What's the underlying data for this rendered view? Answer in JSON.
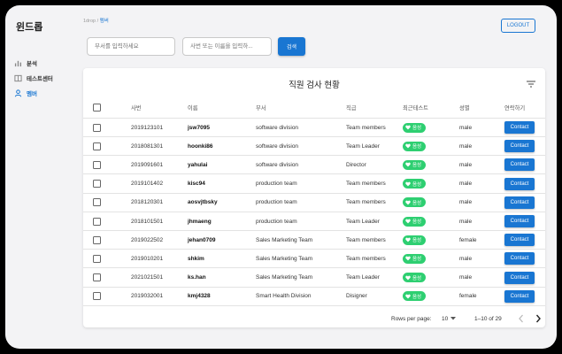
{
  "app": {
    "title": "윈드롭"
  },
  "sidebar": {
    "items": [
      {
        "label": "분석",
        "icon": "bar-chart-icon"
      },
      {
        "label": "테스트센터",
        "icon": "book-icon"
      },
      {
        "label": "멤버",
        "icon": "person-icon"
      }
    ]
  },
  "breadcrumb": {
    "root": "1drop",
    "sep": "/",
    "current": "멤버"
  },
  "header": {
    "logout_label": "LOGOUT"
  },
  "search": {
    "dept_placeholder": "부서를 입력하세요",
    "name_placeholder": "사번 또는 이름을 입력하...",
    "button_label": "검색"
  },
  "table": {
    "title": "직원 검사 현황",
    "columns": [
      "사번",
      "이름",
      "부서",
      "직급",
      "최근테스트",
      "성별",
      "연락하기"
    ],
    "rows": [
      {
        "id": "2019123101",
        "name": "jsw7095",
        "dept": "software division",
        "rank": "Team members",
        "test": "음성",
        "gender": "male",
        "contact": "Contact"
      },
      {
        "id": "2018081301",
        "name": "hoonki86",
        "dept": "software division",
        "rank": "Team Leader",
        "test": "음성",
        "gender": "male",
        "contact": "Contact"
      },
      {
        "id": "2019091601",
        "name": "yahulai",
        "dept": "software division",
        "rank": "Director",
        "test": "음성",
        "gender": "male",
        "contact": "Contact"
      },
      {
        "id": "2019101402",
        "name": "kisc94",
        "dept": "production team",
        "rank": "Team members",
        "test": "음성",
        "gender": "male",
        "contact": "Contact"
      },
      {
        "id": "2018120301",
        "name": "aosvjtbsky",
        "dept": "production team",
        "rank": "Team members",
        "test": "음성",
        "gender": "male",
        "contact": "Contact"
      },
      {
        "id": "2018101501",
        "name": "jhmaeng",
        "dept": "production team",
        "rank": "Team Leader",
        "test": "음성",
        "gender": "male",
        "contact": "Contact"
      },
      {
        "id": "2019022502",
        "name": "jehan0709",
        "dept": "Sales Marketing Team",
        "rank": "Team members",
        "test": "음성",
        "gender": "female",
        "contact": "Contact"
      },
      {
        "id": "2019010201",
        "name": "shkim",
        "dept": "Sales Marketing Team",
        "rank": "Team members",
        "test": "음성",
        "gender": "male",
        "contact": "Contact"
      },
      {
        "id": "2021021501",
        "name": "ks.han",
        "dept": "Sales Marketing Team",
        "rank": "Team Leader",
        "test": "음성",
        "gender": "male",
        "contact": "Contact"
      },
      {
        "id": "2019032001",
        "name": "kmj4328",
        "dept": "Smart Health Division",
        "rank": "Disigner",
        "test": "음성",
        "gender": "female",
        "contact": "Contact"
      }
    ]
  },
  "pagination": {
    "rows_label": "Rows per page:",
    "rows_value": "10",
    "range": "1–10 of 29"
  },
  "colors": {
    "accent": "#1976d2",
    "badge": "#2ecf71",
    "background": "#f3f3f5"
  }
}
